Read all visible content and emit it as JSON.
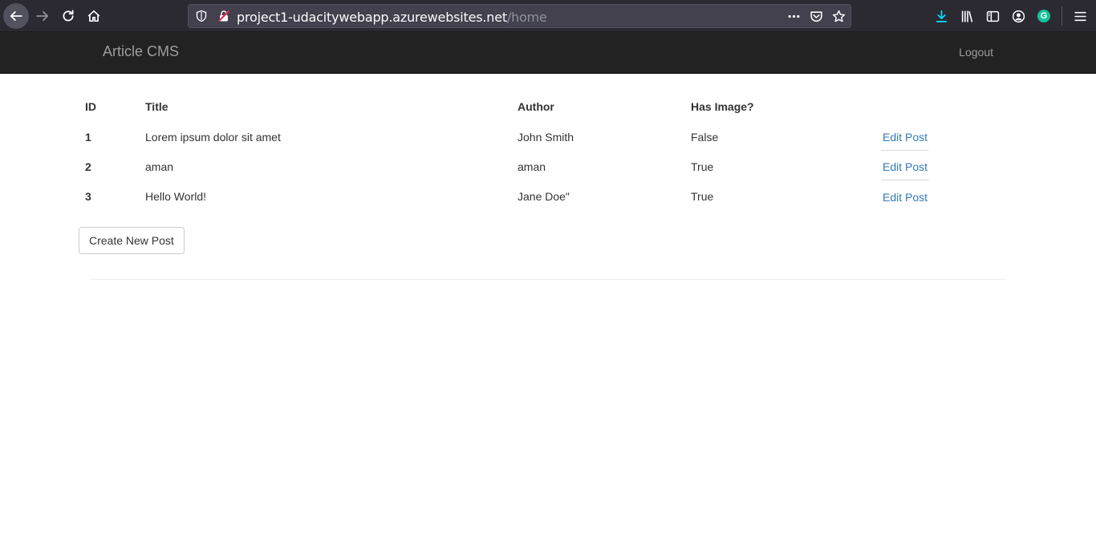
{
  "browser": {
    "url_domain": "project1-udacitywebapp.azurewebsites.net",
    "url_path": "/home",
    "accent_color": "#2b2a33"
  },
  "navbar": {
    "brand": "Article CMS",
    "logout_label": "Logout"
  },
  "table": {
    "headers": [
      "ID",
      "Title",
      "Author",
      "Has Image?",
      ""
    ],
    "rows": [
      {
        "id": "1",
        "title": "Lorem ipsum dolor sit amet",
        "author": "John Smith",
        "has_image": "False",
        "action": "Edit Post"
      },
      {
        "id": "2",
        "title": "aman",
        "author": "aman",
        "has_image": "True",
        "action": "Edit Post"
      },
      {
        "id": "3",
        "title": "Hello World!",
        "author": "Jane Doe\"",
        "has_image": "True",
        "action": "Edit Post"
      }
    ]
  },
  "actions": {
    "create_label": "Create New Post"
  },
  "colors": {
    "link": "#337ab7",
    "navbar_bg": "#222222",
    "navbar_text": "#9d9d9d"
  }
}
